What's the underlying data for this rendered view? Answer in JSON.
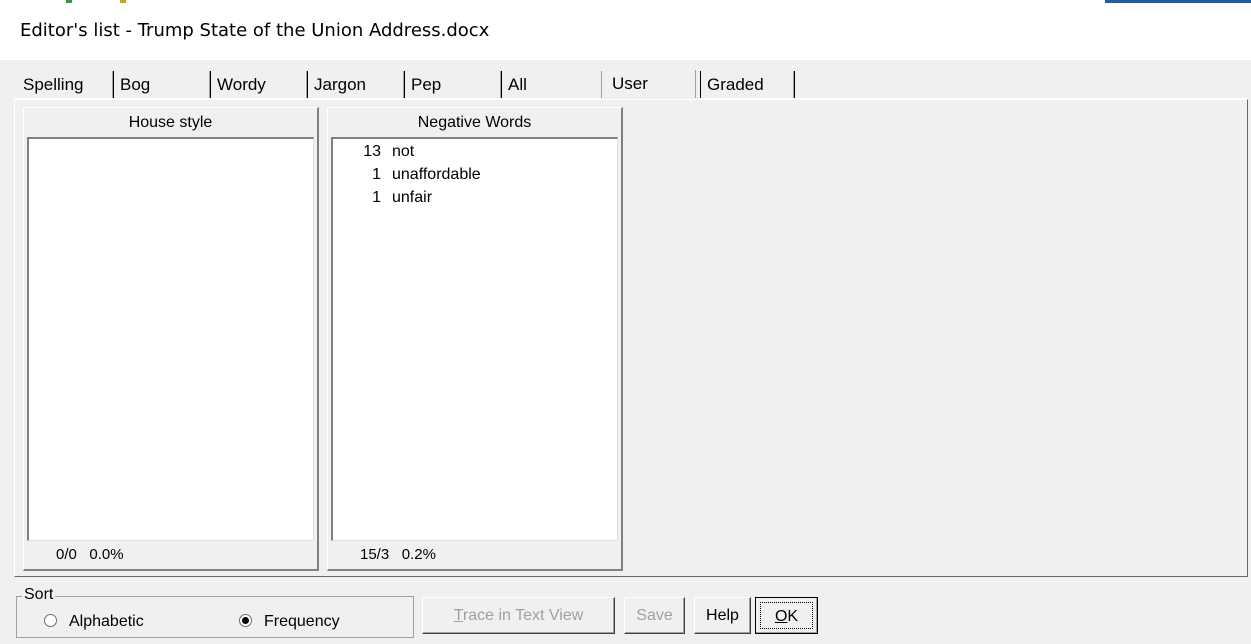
{
  "window": {
    "title": "Editor's list - Trump State of the Union Address.docx"
  },
  "tabs": [
    {
      "label": "Spelling"
    },
    {
      "label": "Bog"
    },
    {
      "label": "Wordy"
    },
    {
      "label": "Jargon"
    },
    {
      "label": "Pep"
    },
    {
      "label": "All"
    },
    {
      "label": "User",
      "active": true
    },
    {
      "label": "Graded"
    }
  ],
  "lists": {
    "house_style": {
      "header": "House style",
      "items": [],
      "footer_count": "0/0",
      "footer_percent": "0.0%"
    },
    "negative_words": {
      "header": "Negative Words",
      "items": [
        {
          "count": "13",
          "word": "not"
        },
        {
          "count": "1",
          "word": "unaffordable"
        },
        {
          "count": "1",
          "word": "unfair"
        }
      ],
      "footer_count": "15/3",
      "footer_percent": "0.2%"
    }
  },
  "sort": {
    "legend": "Sort",
    "options": [
      {
        "label": "Alphabetic",
        "selected": false
      },
      {
        "label": "Frequency",
        "selected": true
      }
    ]
  },
  "buttons": {
    "trace_prefix": "T",
    "trace_rest": "race in Text View",
    "save": "Save",
    "help": "Help",
    "ok_prefix": "O",
    "ok_rest": "K"
  }
}
